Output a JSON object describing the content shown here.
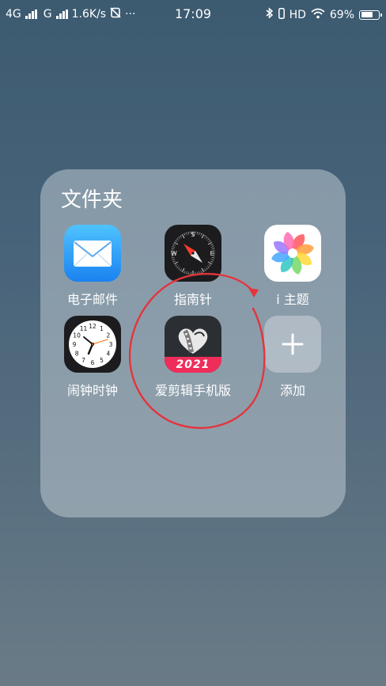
{
  "status_bar": {
    "network1": "4G",
    "network2": "G",
    "speed": "1.6K/s",
    "more": "···",
    "time": "17:09",
    "hd": "HD",
    "battery_text": "69%",
    "battery_level": 0.69
  },
  "folder": {
    "title": "文件夹",
    "apps": [
      {
        "label": "电子邮件",
        "icon": "mail-icon"
      },
      {
        "label": "指南针",
        "icon": "compass-icon"
      },
      {
        "label": "i 主题",
        "icon": "theme-pinwheel-icon"
      },
      {
        "label": "闹钟时钟",
        "icon": "clock-icon"
      },
      {
        "label": "爱剪辑手机版",
        "icon": "film-heart-icon",
        "badge": "2021"
      },
      {
        "label": "添加",
        "icon": "plus-icon"
      }
    ]
  },
  "compass": {
    "north": "S",
    "west": "W",
    "east": "E"
  },
  "clock_numbers": [
    "12",
    "1",
    "2",
    "3",
    "4",
    "5",
    "6",
    "7",
    "8",
    "9",
    "10",
    "11"
  ],
  "colors": {
    "annotation": "#e4343c",
    "edit_band": "#ef2d5b",
    "mail_blue": "#1a82f0"
  }
}
